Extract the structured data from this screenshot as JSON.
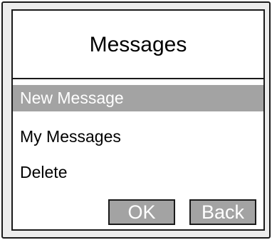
{
  "screen": {
    "title": "Messages"
  },
  "menu": {
    "items": [
      {
        "label": "New Message",
        "selected": true
      },
      {
        "label": "My Messages",
        "selected": false
      },
      {
        "label": "Delete",
        "selected": false
      }
    ]
  },
  "softkeys": {
    "ok_label": "OK",
    "back_label": "Back"
  },
  "colors": {
    "selection": "#a3a3a3",
    "frame": "#ececec",
    "border": "#1a1a1a"
  }
}
